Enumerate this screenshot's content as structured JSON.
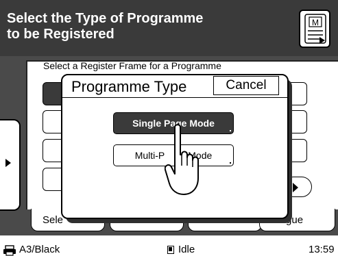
{
  "header": {
    "title_line1": "Select the Type of Programme",
    "title_line2": "to be Registered",
    "memo_icon": "memo-m-icon",
    "background": "#3a3a3a"
  },
  "panel": {
    "caption": "Select a Register Frame for a Programme"
  },
  "tabs": {
    "left_label": "Sele",
    "right_label": "alogue"
  },
  "dialog": {
    "title": "Programme Type",
    "cancel_label": "Cancel",
    "single_page_label": "Single Page Mode",
    "multi_page_label": "Multi-P",
    "multi_page_label_tail": "Mode"
  },
  "status": {
    "paper": "A3/Black",
    "state": "Idle",
    "time": "13:59"
  },
  "icons": {
    "hand": "pointing-hand-icon",
    "printer": "printer-icon",
    "color_mode": "mono-color-icon"
  }
}
